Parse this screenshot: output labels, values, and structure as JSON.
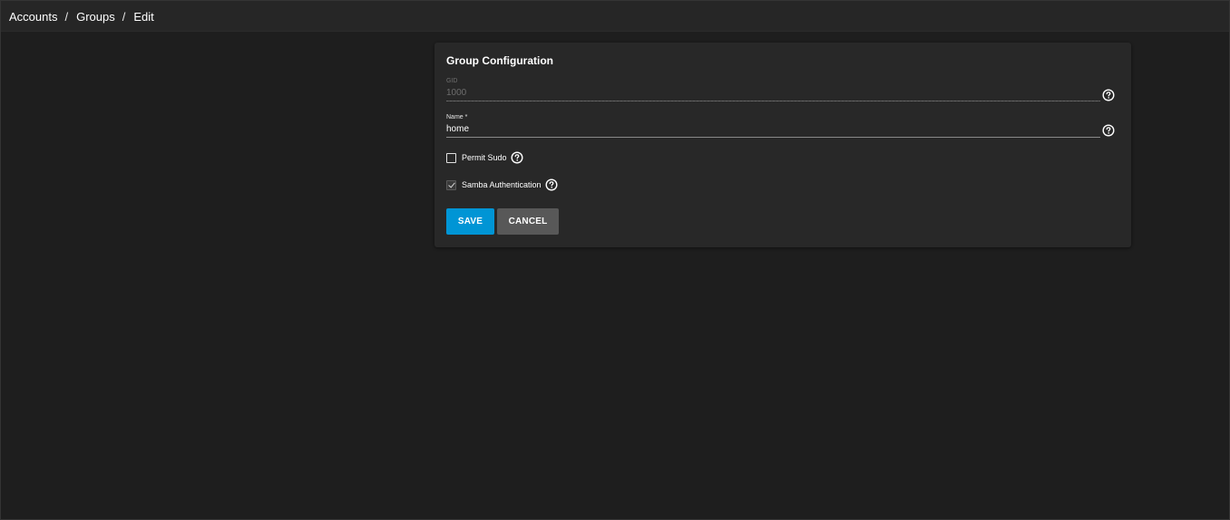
{
  "breadcrumb": {
    "items": [
      "Accounts",
      "Groups",
      "Edit"
    ],
    "separator": "/"
  },
  "card": {
    "title": "Group Configuration"
  },
  "form": {
    "gid": {
      "label": "GID",
      "value": "1000",
      "disabled": true
    },
    "name": {
      "label": "Name *",
      "value": "home"
    },
    "permit_sudo": {
      "label": "Permit Sudo",
      "checked": false
    },
    "samba_auth": {
      "label": "Samba Authentication",
      "checked": true
    }
  },
  "buttons": {
    "save": "SAVE",
    "cancel": "CANCEL"
  },
  "colors": {
    "background": "#1e1e1e",
    "card": "#282828",
    "primary": "#0095d5",
    "secondary": "#585858"
  },
  "icons": {
    "help": "help-circle-icon",
    "checkmark": "checkmark-icon"
  }
}
